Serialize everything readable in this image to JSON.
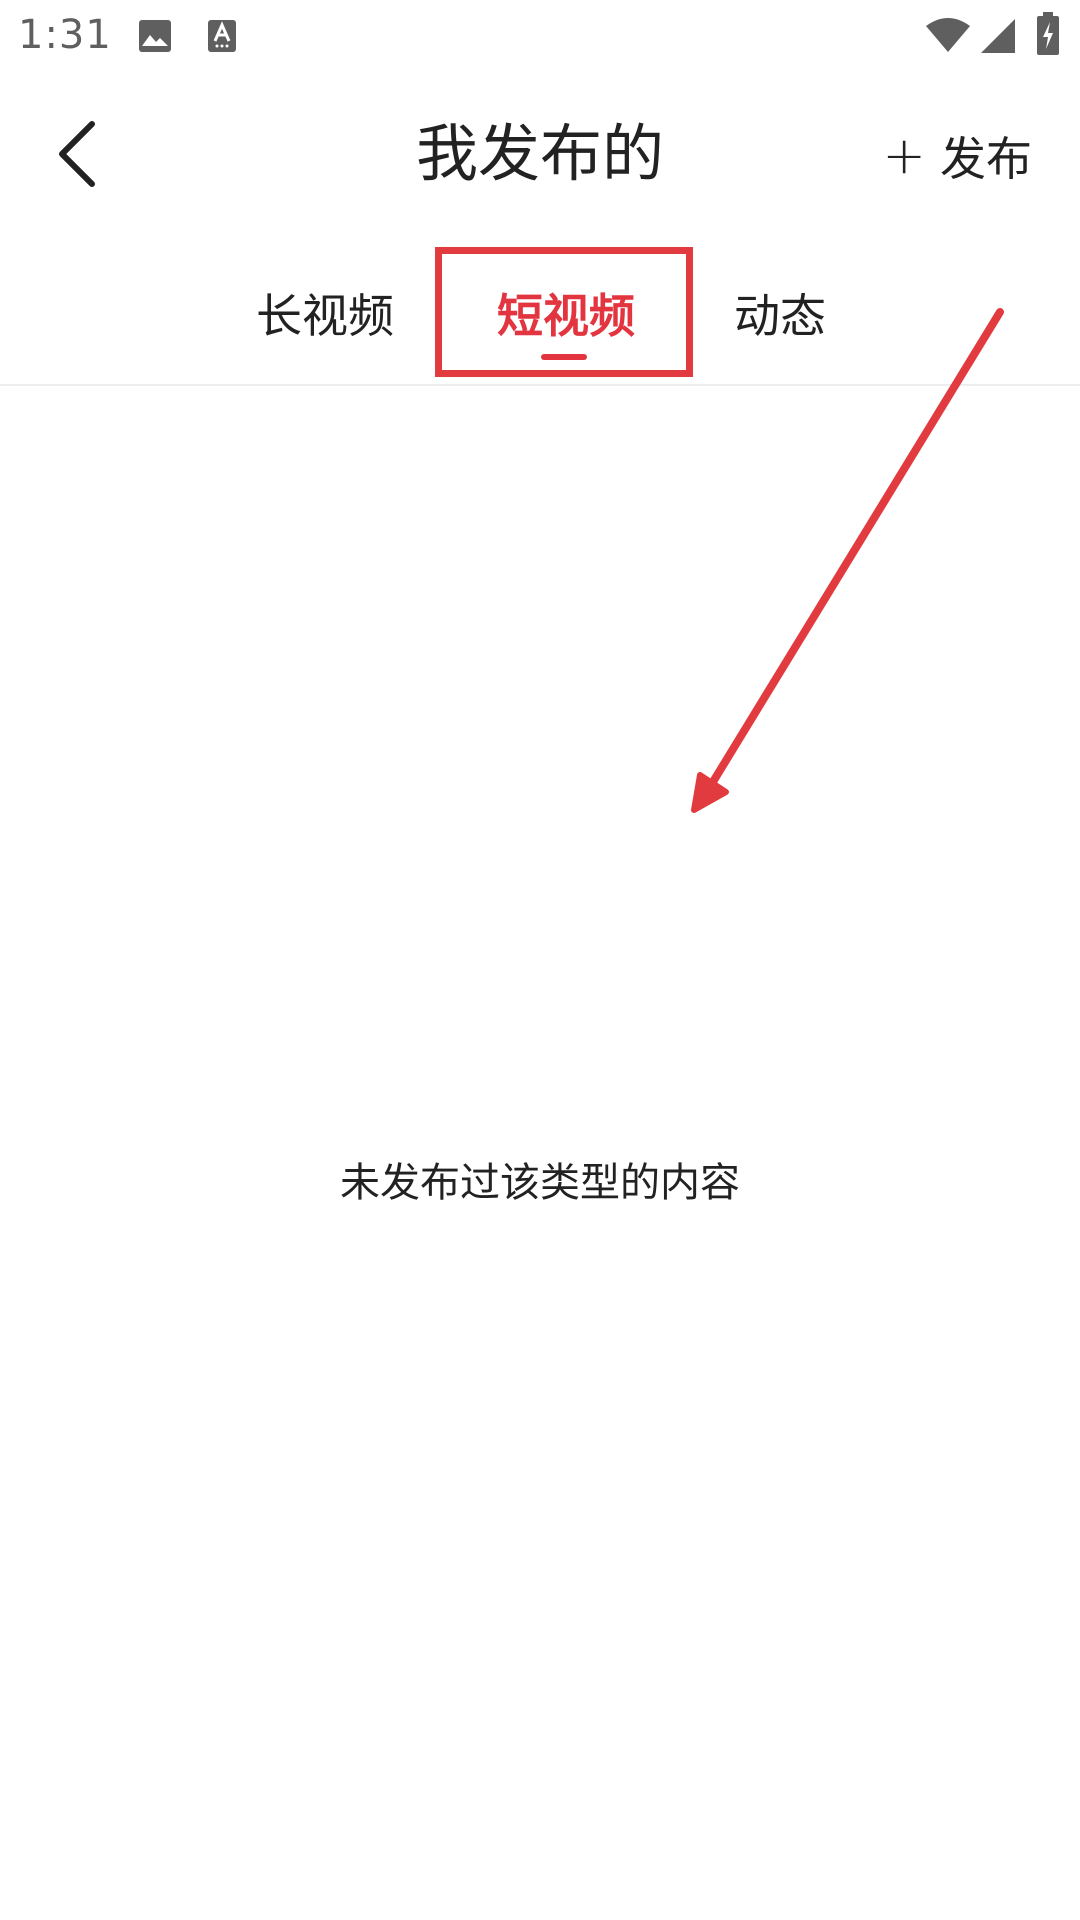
{
  "status_bar": {
    "time": "1:31",
    "icons": [
      "image-icon",
      "a-notification-icon",
      "wifi-icon",
      "signal-icon",
      "battery-icon"
    ]
  },
  "header": {
    "back_icon": "chevron-left-icon",
    "title": "我发布的",
    "publish_icon": "plus-icon",
    "publish_plus": "+",
    "publish_label": "发布"
  },
  "tabs": [
    {
      "label": "长视频",
      "selected": false
    },
    {
      "label": "短视频",
      "selected": true
    },
    {
      "label": "动态",
      "selected": false
    }
  ],
  "empty_state": {
    "message": "未发布过该类型的内容"
  },
  "colors": {
    "accent": "#e3353f",
    "annotation": "#e23b3f",
    "text": "#222222",
    "status_text": "#5f5f5f"
  }
}
